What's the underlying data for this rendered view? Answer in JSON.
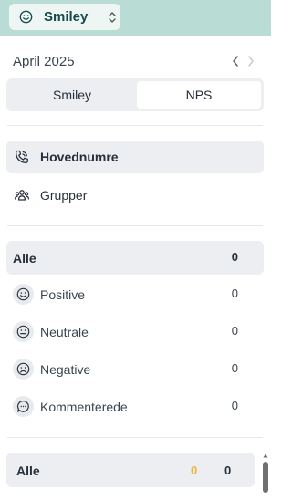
{
  "header": {
    "selector_label": "Smiley",
    "selector_icon": "smiley-icon",
    "toggle_icon": "chevron-updown-icon",
    "bg_color": "#b9dcd5"
  },
  "period": {
    "month_label": "April 2025",
    "prev_icon": "chevron-left-icon",
    "next_icon": "chevron-right-icon"
  },
  "tabs": {
    "smiley": "Smiley",
    "nps": "NPS",
    "active": "NPS"
  },
  "numbers_nav": {
    "items": [
      {
        "label": "Hovednumre",
        "icon": "phone-icon",
        "active": true
      },
      {
        "label": "Grupper",
        "icon": "group-icon",
        "active": false
      }
    ]
  },
  "summary": {
    "label": "Alle",
    "count": "0"
  },
  "filters": [
    {
      "label": "Positive",
      "icon": "smile-face-icon",
      "count": "0"
    },
    {
      "label": "Neutrale",
      "icon": "neutral-face-icon",
      "count": "0"
    },
    {
      "label": "Negative",
      "icon": "sad-face-icon",
      "count": "0"
    },
    {
      "label": "Kommenterede",
      "icon": "comment-icon",
      "count": "0"
    }
  ],
  "footer_row": {
    "label": "Alle",
    "count_highlight": "0",
    "count": "0",
    "highlight_color": "#f0b33c"
  }
}
